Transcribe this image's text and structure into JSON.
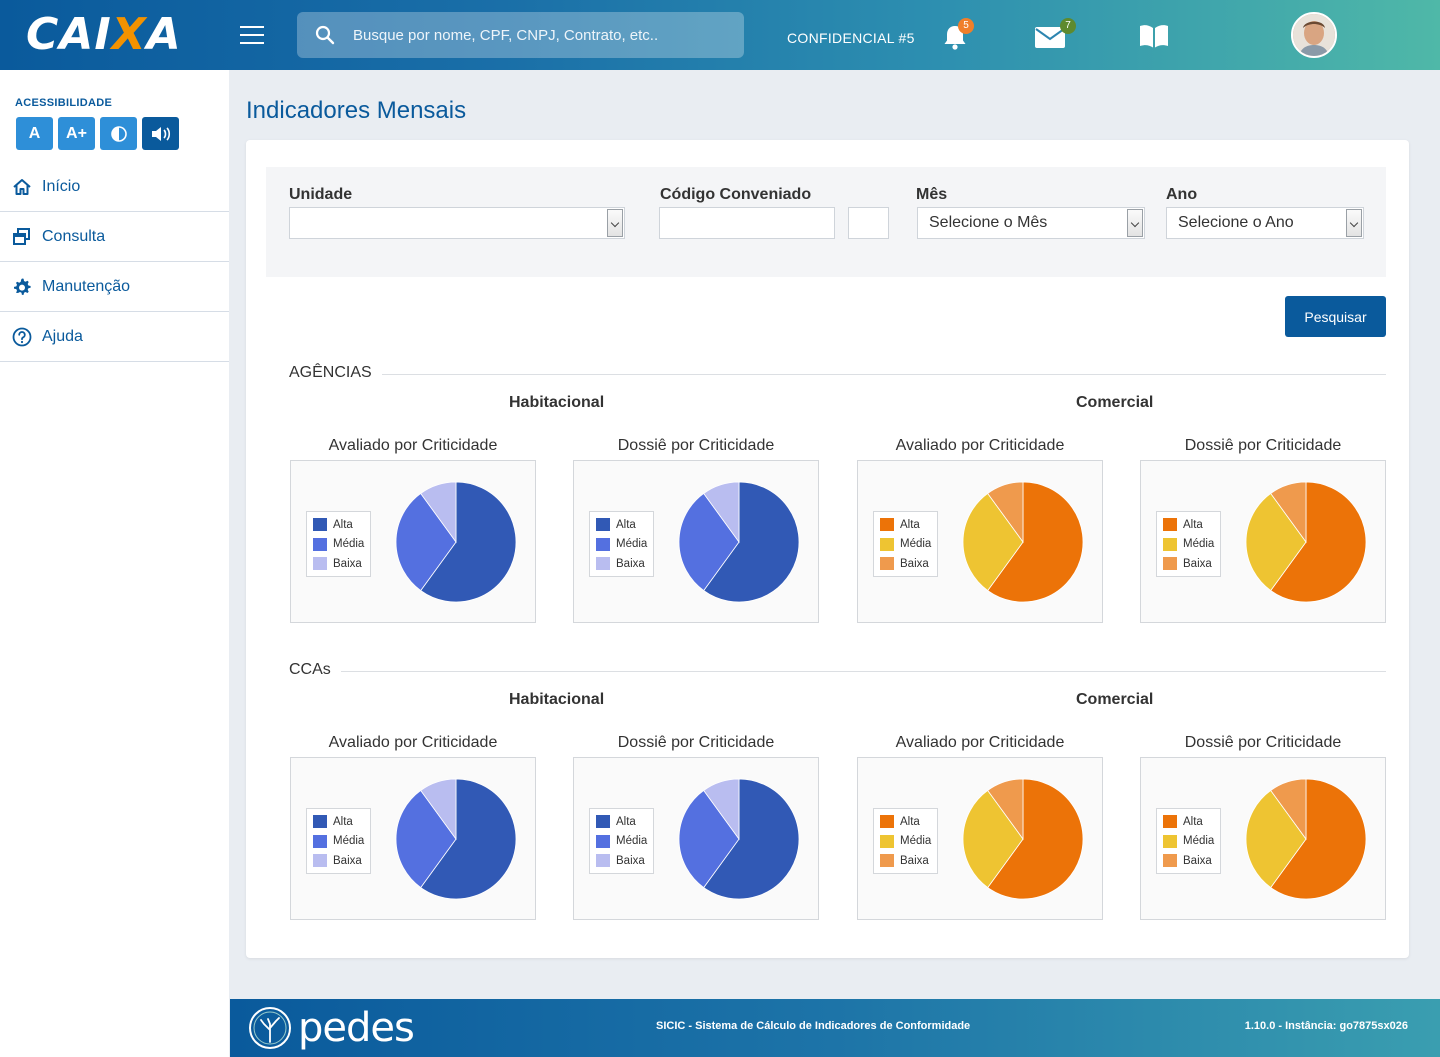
{
  "header": {
    "logo_left": "CAI",
    "logo_x": "X",
    "logo_right": "A",
    "search_placeholder": "Busque por nome, CPF, CNPJ, Contrato, etc..",
    "confidential": "CONFIDENCIAL #5",
    "notifications_count": "5",
    "messages_count": "7"
  },
  "sidebar": {
    "accessibility_title": "ACESSIBILIDADE",
    "acc_buttons": [
      "A",
      "A+"
    ],
    "items": [
      {
        "label": "Início",
        "icon": "home-icon"
      },
      {
        "label": "Consulta",
        "icon": "windows-icon"
      },
      {
        "label": "Manutenção",
        "icon": "gear-icon"
      },
      {
        "label": "Ajuda",
        "icon": "help-icon"
      }
    ]
  },
  "main": {
    "title": "Indicadores Mensais",
    "filters": {
      "unidade_label": "Unidade",
      "unidade_value": "",
      "codigo_label": "Código Conveniado",
      "mes_label": "Mês",
      "mes_value": "Selecione o Mês",
      "ano_label": "Ano",
      "ano_value": "Selecione o Ano"
    },
    "search_button": "Pesquisar",
    "sections": [
      {
        "title": "AGÊNCIAS",
        "groups": [
          "Habitacional",
          "Comercial"
        ]
      },
      {
        "title": "CCAs",
        "groups": [
          "Habitacional",
          "Comercial"
        ]
      }
    ],
    "chart_titles": [
      "Avaliado por Criticidade",
      "Dossiê por Criticidade",
      "Avaliado por Criticidade",
      "Dossiê por Criticidade"
    ],
    "legend_labels": [
      "Alta",
      "Média",
      "Baixa"
    ]
  },
  "colors": {
    "blue_palette": [
      "#3159b5",
      "#5470e0",
      "#b9bdf0"
    ],
    "orange_palette": [
      "#ec7308",
      "#eec432",
      "#ef9a4d"
    ]
  },
  "chart_data": [
    {
      "type": "pie",
      "section": "AGÊNCIAS",
      "group": "Habitacional",
      "title": "Avaliado por Criticidade",
      "labels": [
        "Alta",
        "Média",
        "Baixa"
      ],
      "values": [
        60,
        30,
        10
      ]
    },
    {
      "type": "pie",
      "section": "AGÊNCIAS",
      "group": "Habitacional",
      "title": "Dossiê por Criticidade",
      "labels": [
        "Alta",
        "Média",
        "Baixa"
      ],
      "values": [
        60,
        30,
        10
      ]
    },
    {
      "type": "pie",
      "section": "AGÊNCIAS",
      "group": "Comercial",
      "title": "Avaliado por Criticidade",
      "labels": [
        "Alta",
        "Média",
        "Baixa"
      ],
      "values": [
        60,
        30,
        10
      ]
    },
    {
      "type": "pie",
      "section": "AGÊNCIAS",
      "group": "Comercial",
      "title": "Dossiê por Criticidade",
      "labels": [
        "Alta",
        "Média",
        "Baixa"
      ],
      "values": [
        60,
        30,
        10
      ]
    },
    {
      "type": "pie",
      "section": "CCAs",
      "group": "Habitacional",
      "title": "Avaliado por Criticidade",
      "labels": [
        "Alta",
        "Média",
        "Baixa"
      ],
      "values": [
        60,
        30,
        10
      ]
    },
    {
      "type": "pie",
      "section": "CCAs",
      "group": "Habitacional",
      "title": "Dossiê por Criticidade",
      "labels": [
        "Alta",
        "Média",
        "Baixa"
      ],
      "values": [
        60,
        30,
        10
      ]
    },
    {
      "type": "pie",
      "section": "CCAs",
      "group": "Comercial",
      "title": "Avaliado por Criticidade",
      "labels": [
        "Alta",
        "Média",
        "Baixa"
      ],
      "values": [
        60,
        30,
        10
      ]
    },
    {
      "type": "pie",
      "section": "CCAs",
      "group": "Comercial",
      "title": "Dossiê por Criticidade",
      "labels": [
        "Alta",
        "Média",
        "Baixa"
      ],
      "values": [
        60,
        30,
        10
      ]
    }
  ],
  "footer": {
    "brand": "pedes",
    "system": "SICIC  - Sistema de Cálculo de Indicadores de Conformidade",
    "version": "1.10.0 - Instância: go7875sx026"
  }
}
